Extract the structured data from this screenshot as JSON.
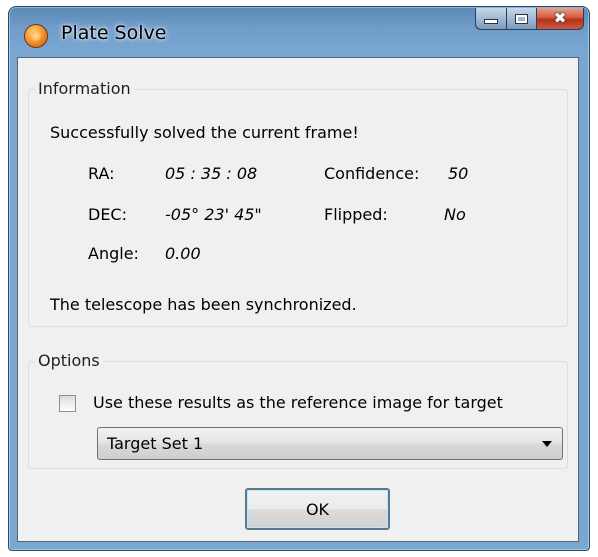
{
  "window": {
    "title": "Plate Solve",
    "icon": "app-orange-orb-icon",
    "caption_buttons": {
      "minimize": "minimize-icon",
      "maximize": "maximize-icon",
      "close": "✖"
    }
  },
  "information": {
    "legend": "Information",
    "status": "Successfully solved the current frame!",
    "ra_label": "RA:",
    "ra_value": "05 : 35 : 08",
    "confidence_label": "Confidence:",
    "confidence_value": "50",
    "dec_label": "DEC:",
    "dec_value": "-05° 23' 45\"",
    "flipped_label": "Flipped:",
    "flipped_value": "No",
    "angle_label": "Angle:",
    "angle_value": "0.00",
    "sync_message": "The telescope has been synchronized."
  },
  "options": {
    "legend": "Options",
    "checkbox_label": "Use these results as the reference image for target",
    "checkbox_checked": false,
    "target_selected": "Target Set 1"
  },
  "buttons": {
    "ok": "OK"
  },
  "colors": {
    "frame": "#7aa7d2",
    "client": "#f0f0f0",
    "close_button": "#c8462b"
  }
}
